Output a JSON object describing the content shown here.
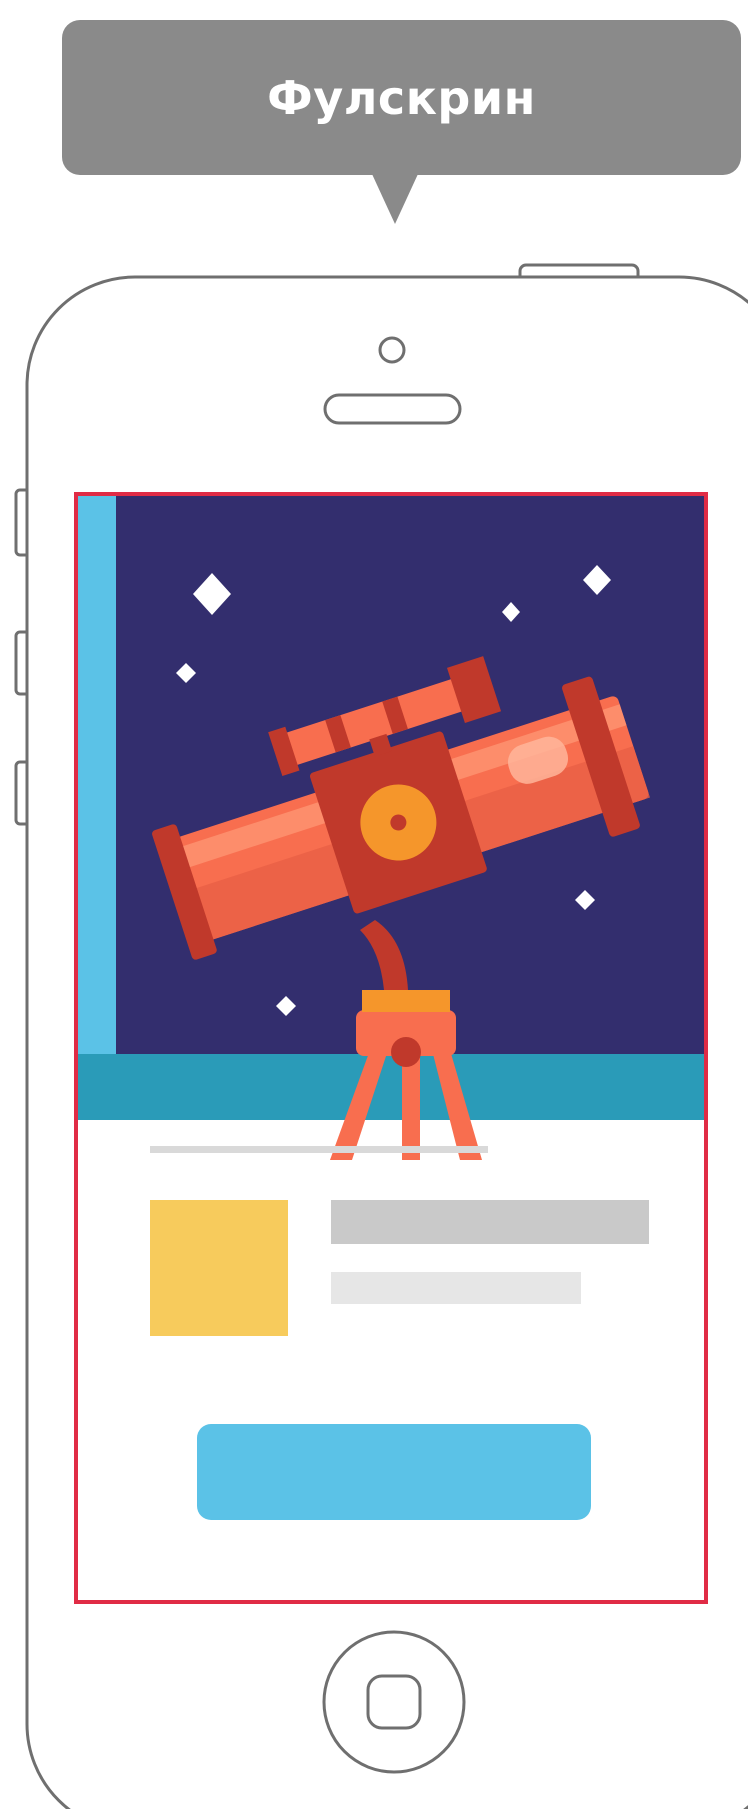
{
  "tooltip": {
    "label": "Фулскрин"
  },
  "colors": {
    "tooltip_bg": "#8a8a8a",
    "phone_outline": "#6f6f6f",
    "selection_border": "#e02b45",
    "night_sky": "#332e6e",
    "wall_accent": "#5bc2e7",
    "floor": "#2a9bb8",
    "telescope_body": "#f86e4f",
    "telescope_dark": "#c0392b",
    "telescope_highlight": "#ff9a78",
    "knob": "#f5962b",
    "thumbnail": "#f7cb5c",
    "title_placeholder": "#c9c9c9",
    "subtitle_placeholder": "#e6e6e6",
    "cta_button": "#5bc2e7"
  },
  "icons": {
    "front_camera": "camera-icon",
    "speaker": "speaker-icon",
    "home_button": "home-button-icon",
    "stars": "star-icon",
    "telescope": "telescope-icon"
  }
}
